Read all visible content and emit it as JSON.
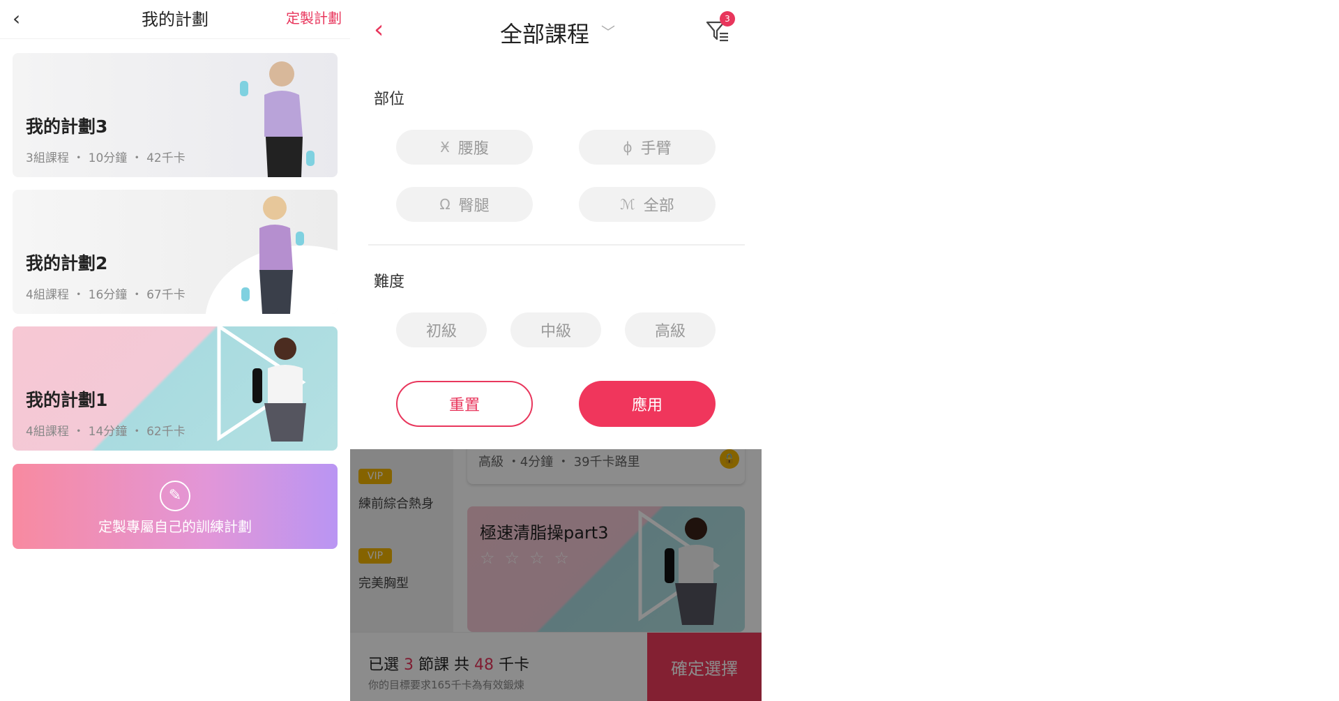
{
  "left": {
    "header": {
      "back_icon": "‹",
      "title": "我的計劃",
      "custom_link": "定製計劃"
    },
    "plans": [
      {
        "name": "我的計劃3",
        "courses": "3組課程",
        "minutes": "10分鐘",
        "calories": "42千卡"
      },
      {
        "name": "我的計劃2",
        "courses": "4組課程",
        "minutes": "16分鐘",
        "calories": "67千卡"
      },
      {
        "name": "我的計劃1",
        "courses": "4組課程",
        "minutes": "14分鐘",
        "calories": "62千卡"
      }
    ],
    "meta_separator": "・",
    "cta": {
      "label": "定製專屬自己的訓練計劃",
      "icon": "pencil-icon"
    }
  },
  "right": {
    "header": {
      "back_icon": "‹",
      "title": "全部課程",
      "chevron_icon": "chevron-down-icon",
      "filter_badge": "3"
    },
    "body_part": {
      "label": "部位",
      "options": [
        {
          "label": "腰腹",
          "icon": "waist-icon"
        },
        {
          "label": "手臂",
          "icon": "arm-icon"
        },
        {
          "label": "臀腿",
          "icon": "hip-icon"
        },
        {
          "label": "全部",
          "icon": "body-icon"
        }
      ]
    },
    "difficulty": {
      "label": "難度",
      "options": [
        {
          "label": "初級"
        },
        {
          "label": "中級"
        },
        {
          "label": "高級"
        }
      ]
    },
    "actions": {
      "reset": "重置",
      "apply": "應用"
    },
    "background_list": {
      "top_card_meta": "高級 ・4分鐘 ・ 39千卡路里",
      "vip_items": [
        {
          "badge": "VIP",
          "label": "練前綜合熱身"
        },
        {
          "badge": "VIP",
          "label": "完美胸型"
        }
      ],
      "course_card": {
        "title": "極速清脂操part3",
        "stars": "☆☆☆☆"
      },
      "summary": {
        "prefix": "已選",
        "count": "3",
        "mid": "節課 共",
        "calories": "48",
        "unit": "千卡"
      },
      "hint": "你的目標要求165千卡為有效鍛煉",
      "confirm": "確定選擇"
    },
    "colors": {
      "accent": "#e8365c",
      "vip": "#f3b400"
    }
  }
}
